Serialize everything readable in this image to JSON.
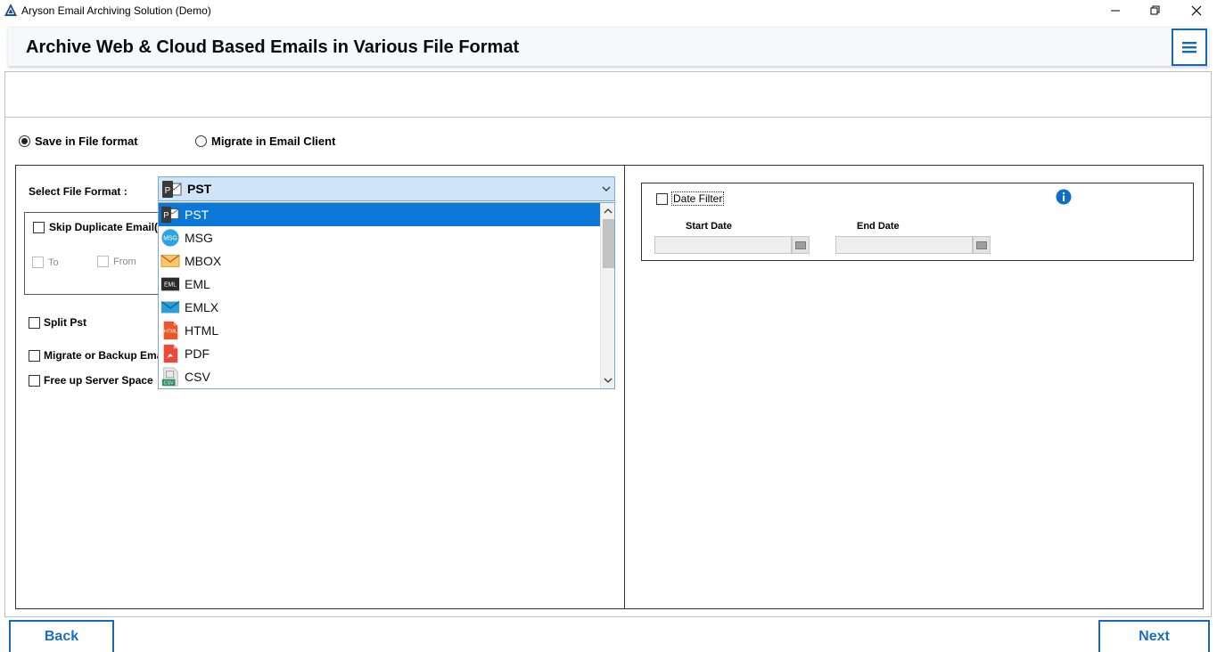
{
  "window": {
    "title": "Aryson Email Archiving Solution (Demo)"
  },
  "header": {
    "title": "Archive Web & Cloud Based Emails in Various File Format"
  },
  "mode": {
    "save_label": "Save in File format",
    "migrate_label": "Migrate in Email Client",
    "selected": "save"
  },
  "left": {
    "format_label": "Select File Format :",
    "selected_format": "PST",
    "skip_duplicate_label": "Skip Duplicate Email(s",
    "to_label": "To",
    "from_label": "From",
    "split_pst_label": "Split Pst",
    "migrate_backup_label": "Migrate or Backup Ema",
    "free_space_label": "Free up Server Space"
  },
  "formats": [
    {
      "label": "PST",
      "icon": "pst-icon"
    },
    {
      "label": "MSG",
      "icon": "msg-icon"
    },
    {
      "label": "MBOX",
      "icon": "mbox-icon"
    },
    {
      "label": "EML",
      "icon": "eml-icon"
    },
    {
      "label": "EMLX",
      "icon": "emlx-icon"
    },
    {
      "label": "HTML",
      "icon": "html-icon"
    },
    {
      "label": "PDF",
      "icon": "pdf-icon"
    },
    {
      "label": "CSV",
      "icon": "csv-icon"
    }
  ],
  "icon_text": {
    "pst": "P",
    "msg": "MSG",
    "eml": "EML",
    "html": "HTML",
    "csv": "CSV"
  },
  "right": {
    "date_filter_label": "Date Filter",
    "start_date_label": "Start Date",
    "end_date_label": "End Date",
    "start_date_value": "",
    "end_date_value": ""
  },
  "nav": {
    "back_label": "Back",
    "next_label": "Next"
  },
  "colors": {
    "accent": "#1669b5",
    "selection": "#0b78d7",
    "combo_bg": "#cfe4f7",
    "info": "#0b6fc7"
  }
}
